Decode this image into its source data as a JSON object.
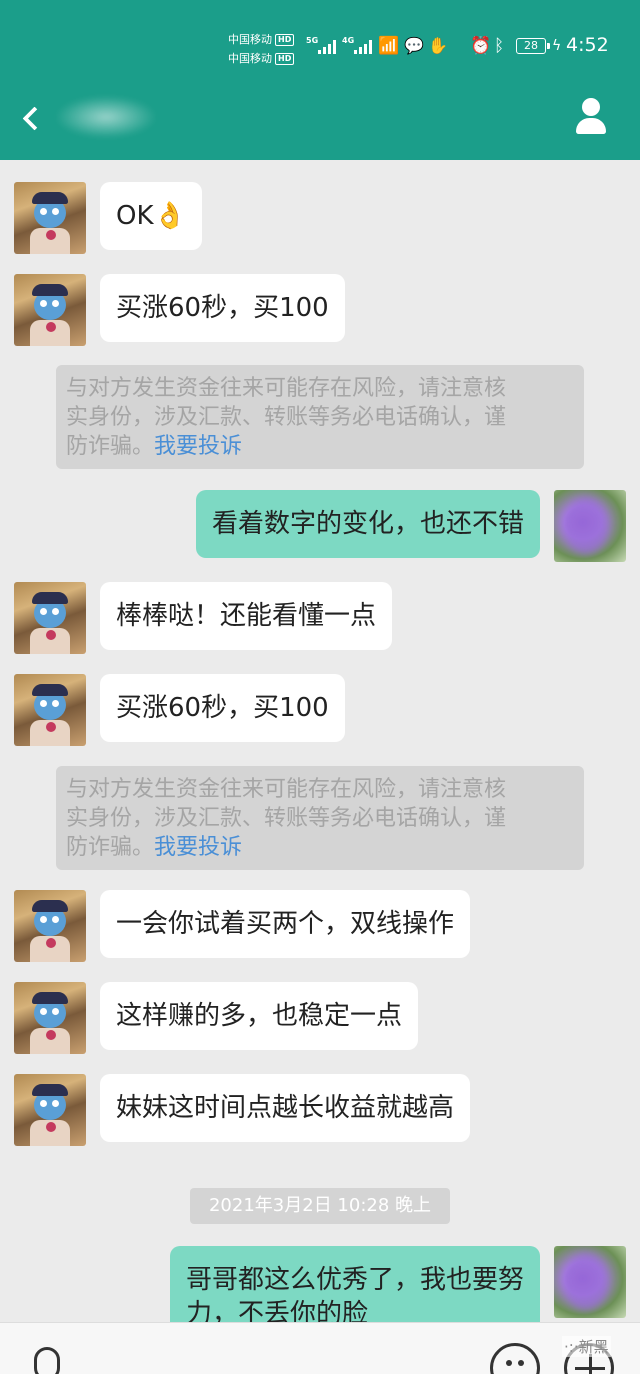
{
  "status_bar": {
    "carrier_1": "中国移动",
    "carrier_2": "中国移动",
    "hd_badge": "HD",
    "net_1": "5G",
    "net_2": "4G",
    "battery": "28",
    "time": "4:52",
    "icons": [
      "signal-icon",
      "signal-icon",
      "wifi-icon",
      "wechat-icon",
      "hand-icon",
      "alarm-icon",
      "bluetooth-icon",
      "battery-icon",
      "charging-icon"
    ]
  },
  "header": {
    "back_icon": "back-icon",
    "profile_icon": "profile-icon",
    "background_color": "#1b9e8a"
  },
  "messages": [
    {
      "side": "in",
      "text": "OK👌"
    },
    {
      "side": "in",
      "text": "买涨60秒，买100"
    },
    {
      "side": "notice",
      "lines": [
        "与对方发生资金往来可能存在风险，请注意核",
        "实身份，涉及汇款、转账等务必电话确认，谨",
        "防诈骗。"
      ],
      "link": "我要投诉"
    },
    {
      "side": "out",
      "text": "看着数字的变化，也还不错"
    },
    {
      "side": "in",
      "text": "棒棒哒！还能看懂一点"
    },
    {
      "side": "in",
      "text": "买涨60秒，买100"
    },
    {
      "side": "notice",
      "lines": [
        "与对方发生资金往来可能存在风险，请注意核",
        "实身份，涉及汇款、转账等务必电话确认，谨",
        "防诈骗。"
      ],
      "link": "我要投诉"
    },
    {
      "side": "in",
      "text": "一会你试着买两个，双线操作"
    },
    {
      "side": "in",
      "text": "这样赚的多，也稳定一点"
    },
    {
      "side": "in",
      "text": "妹妹这时间点越长收益就越高"
    },
    {
      "side": "timestamp",
      "text": "2021年3月2日 10:28 晚上"
    },
    {
      "side": "out",
      "lines": [
        "哥哥都这么优秀了，我也要努",
        "力，不丢你的脸"
      ]
    }
  ],
  "toolbar": {
    "voice_icon": "microphone-icon",
    "emoji_icon": "emoji-icon",
    "more_icon": "plus-icon"
  },
  "watermark": "·:·新黑",
  "colors": {
    "incoming_bubble": "#ffffff",
    "outgoing_bubble": "#7dd9c3",
    "notice_bg": "#d4d4d4",
    "link": "#4a8fd6",
    "chat_bg": "#ebebeb"
  }
}
